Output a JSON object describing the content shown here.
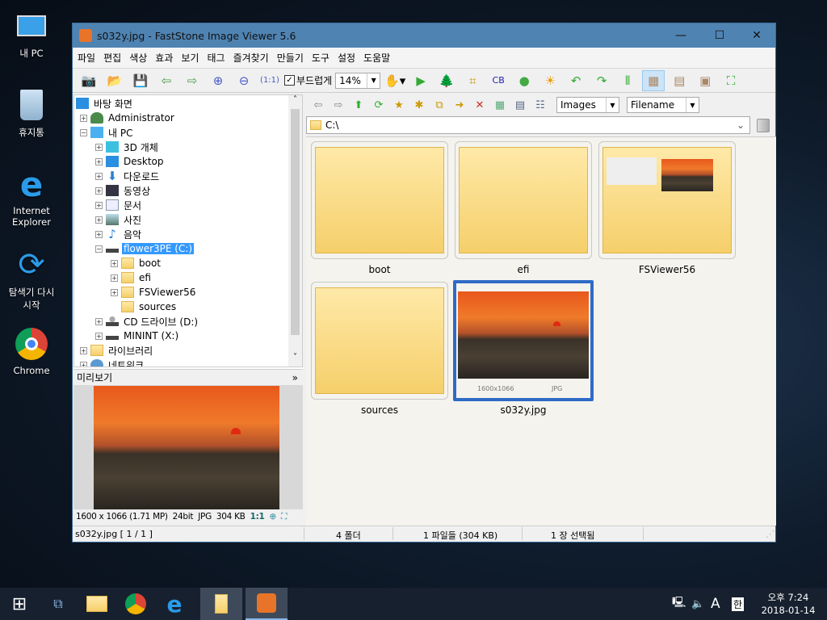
{
  "desktop": {
    "icons": [
      {
        "label": "내 PC",
        "icon": "pc-icon"
      },
      {
        "label": "휴지통",
        "icon": "recycle-bin-icon"
      },
      {
        "label": "Internet Explorer",
        "icon": "ie-icon"
      },
      {
        "label": "탐색기 다시 시작",
        "icon": "refresh-icon"
      },
      {
        "label": "Chrome",
        "icon": "chrome-icon"
      }
    ]
  },
  "window": {
    "title": "s032y.jpg  -  FastStone Image Viewer 5.6",
    "menu": [
      "파일",
      "편집",
      "색상",
      "효과",
      "보기",
      "태그",
      "즐겨찾기",
      "만들기",
      "도구",
      "설정",
      "도움말"
    ],
    "toolbar": {
      "smooth_label": "부드럽게",
      "smooth_checked": true,
      "zoom": "14%"
    },
    "tree": [
      {
        "label": "바탕 화면"
      },
      {
        "label": "Administrator"
      },
      {
        "label": "내 PC"
      },
      {
        "label": "3D 개체"
      },
      {
        "label": "Desktop"
      },
      {
        "label": "다운로드"
      },
      {
        "label": "동영상"
      },
      {
        "label": "문서"
      },
      {
        "label": "사진"
      },
      {
        "label": "음악"
      },
      {
        "label": "flower3PE (C:)",
        "selected": true
      },
      {
        "label": "boot"
      },
      {
        "label": "efi"
      },
      {
        "label": "FSViewer56"
      },
      {
        "label": "sources"
      },
      {
        "label": "CD 드라이브 (D:)"
      },
      {
        "label": "MININT (X:)"
      },
      {
        "label": "라이브러리"
      },
      {
        "label": "네트워크"
      }
    ],
    "preview": {
      "header": "미리보기",
      "info": {
        "dims": "1600 x 1066 (1.71 MP)",
        "bits": "24bit",
        "format": "JPG",
        "size": "304 KB",
        "ratio": "1:1"
      }
    },
    "browser": {
      "filter": "Images",
      "sort": "Filename",
      "path": "C:\\",
      "items": [
        {
          "name": "boot",
          "type": "folder"
        },
        {
          "name": "efi",
          "type": "folder"
        },
        {
          "name": "FSViewer56",
          "type": "folder"
        },
        {
          "name": "sources",
          "type": "folder"
        },
        {
          "name": "s032y.jpg",
          "type": "image",
          "dims": "1600x1066",
          "format": "JPG",
          "selected": true
        }
      ]
    },
    "status": {
      "file": "s032y.jpg [ 1 / 1 ]",
      "folders": "4 폴더",
      "files": "1 파일들 (304 KB)",
      "selected": "1 장 선택됨"
    }
  },
  "taskbar": {
    "time": "오후 7:24",
    "date": "2018-01-14",
    "ime": "A",
    "lang": "한"
  },
  "colors": {
    "titlebar": "#4f83b2",
    "selection": "#3399ff",
    "thumb_selected": "#2f6bc6"
  }
}
